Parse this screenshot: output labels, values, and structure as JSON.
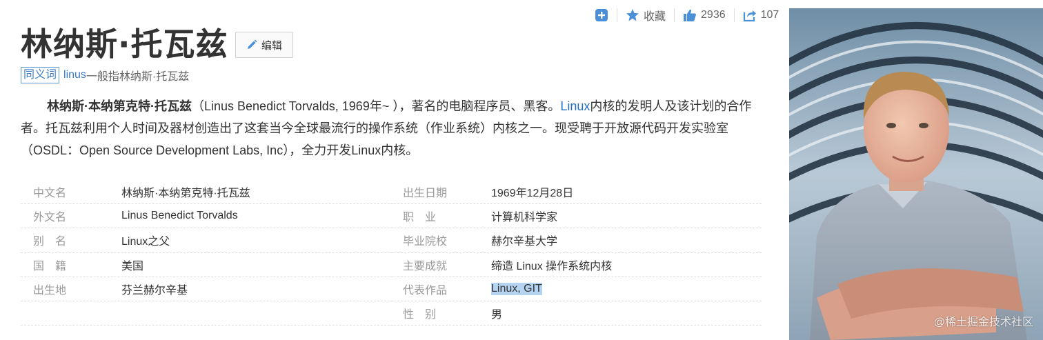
{
  "actions": {
    "collect_label": "收藏",
    "like_count": "2936",
    "share_count": "107"
  },
  "title": "林纳斯·托瓦兹",
  "edit_label": "编辑",
  "synonym": {
    "badge": "同义词",
    "link": "linus",
    "rest": "一般指林纳斯·托瓦兹"
  },
  "summary": {
    "name_bold": "林纳斯·本纳第克特·托瓦兹",
    "part1": "（Linus Benedict Torvalds, 1969年~ ），著名的电脑程序员、黑客。",
    "link": "Linux",
    "part2": "内核的发明人及该计划的合作者。托瓦兹利用个人时间及器材创造出了这套当今全球最流行的操作系统（作业系统）内核之一。现受聘于开放源代码开发实验室（OSDL：Open Source Development Labs, Inc），全力开发Linux内核。"
  },
  "info_left": [
    {
      "key": "中文名",
      "value": "林纳斯·本纳第克特·托瓦兹"
    },
    {
      "key": "外文名",
      "value": "Linus Benedict Torvalds"
    },
    {
      "key": "别　名",
      "value": "Linux之父"
    },
    {
      "key": "国　籍",
      "value": "美国"
    },
    {
      "key": "出生地",
      "value": "芬兰赫尔辛基"
    }
  ],
  "info_right": [
    {
      "key": "出生日期",
      "value": "1969年12月28日"
    },
    {
      "key": "职　业",
      "value": "计算机科学家"
    },
    {
      "key": "毕业院校",
      "value": "赫尔辛基大学"
    },
    {
      "key": "主要成就",
      "value": "缔造 Linux 操作系统内核"
    },
    {
      "key": "代表作品",
      "value": "Linux, GIT"
    },
    {
      "key": "性　别",
      "value": "男"
    }
  ],
  "watermark": "@稀土掘金技术社区",
  "colors": {
    "link": "#3a7bc8",
    "icon": "#4a90d9",
    "highlight": "#b5d4f2"
  }
}
